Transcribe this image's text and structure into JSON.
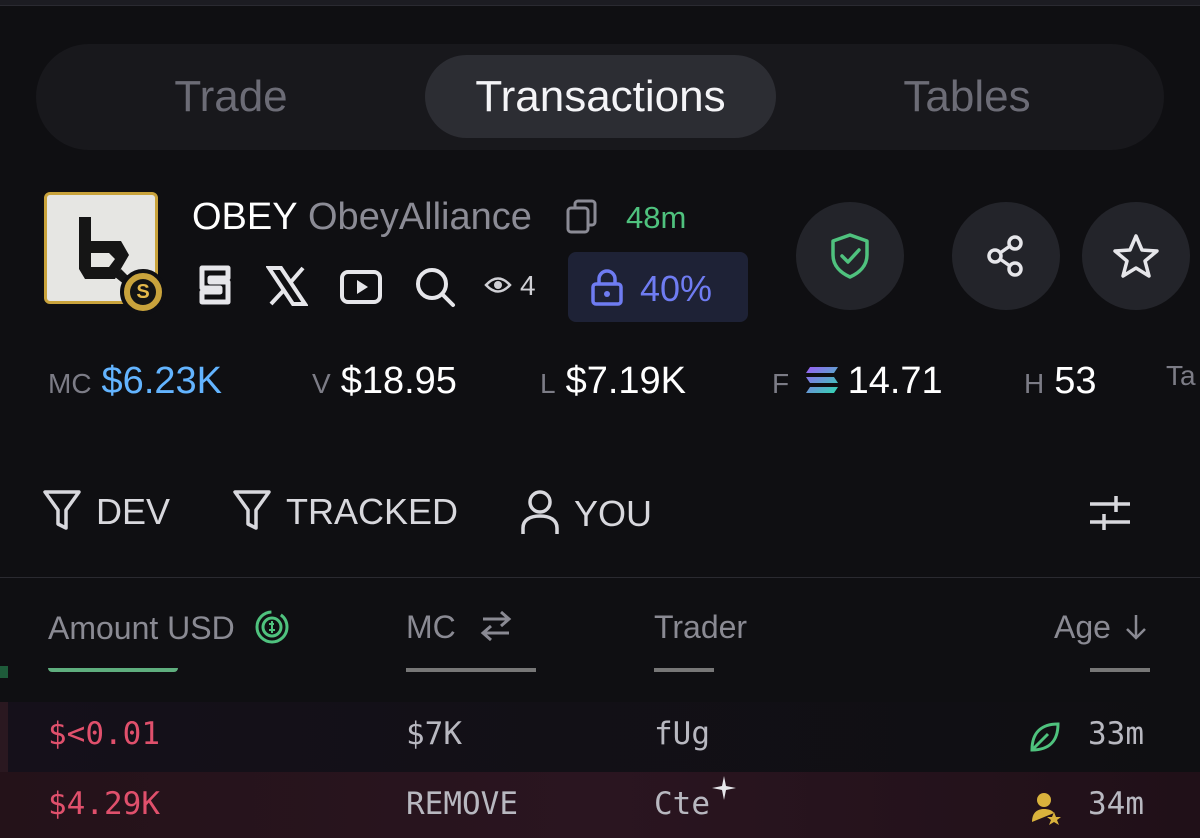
{
  "tabs": [
    {
      "label": "Trade"
    },
    {
      "label": "Transactions"
    },
    {
      "label": "Tables"
    }
  ],
  "token": {
    "ticker": "OBEY",
    "name": "ObeyAlliance",
    "age": "48m",
    "views": "4",
    "lock_percent": "40%"
  },
  "stats": {
    "mc_label": "MC",
    "mc_value": "$6.23K",
    "v_label": "V",
    "v_value": "$18.95",
    "l_label": "L",
    "l_value": "$7.19K",
    "f_label": "F",
    "f_value": "14.71",
    "h_label": "H",
    "h_value": "53",
    "t_label": "Ta"
  },
  "filters": {
    "dev": "DEV",
    "tracked": "TRACKED",
    "you": "YOU"
  },
  "table": {
    "headers": {
      "amount": "Amount USD",
      "mc": "MC",
      "trader": "Trader",
      "age": "Age"
    },
    "rows": [
      {
        "amount": "$<0.01",
        "mc": "$7K",
        "trader": "fUg",
        "age": "33m"
      },
      {
        "amount": "$4.29K",
        "mc": "REMOVE",
        "trader": "Cte",
        "age": "34m"
      }
    ]
  },
  "colors": {
    "accent_green": "#4fc27e",
    "mc_blue": "#63b4ff",
    "sell_red": "#e0506c",
    "lock_purple": "#6f7cf2",
    "badge_gold": "#c9a33c"
  }
}
